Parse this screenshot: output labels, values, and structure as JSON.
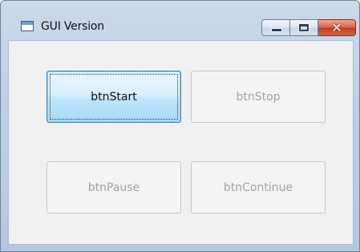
{
  "window": {
    "title": "GUI Version",
    "icons": {
      "app": "application-window-icon",
      "minimize": "minimize-icon",
      "maximize": "maximize-icon",
      "close": "close-icon"
    },
    "close_glyph": "✕"
  },
  "buttons": {
    "start": {
      "label": "btnStart",
      "enabled": true
    },
    "stop": {
      "label": "btnStop",
      "enabled": false
    },
    "pause": {
      "label": "btnPause",
      "enabled": false
    },
    "continue": {
      "label": "btnContinue",
      "enabled": false
    }
  },
  "colors": {
    "titlebar": "#bcd0e5",
    "client_background": "#f0f0f0",
    "active_button_border": "#3c7fb1",
    "disabled_text": "#a3a3a3",
    "close_button": "#c23d21"
  }
}
